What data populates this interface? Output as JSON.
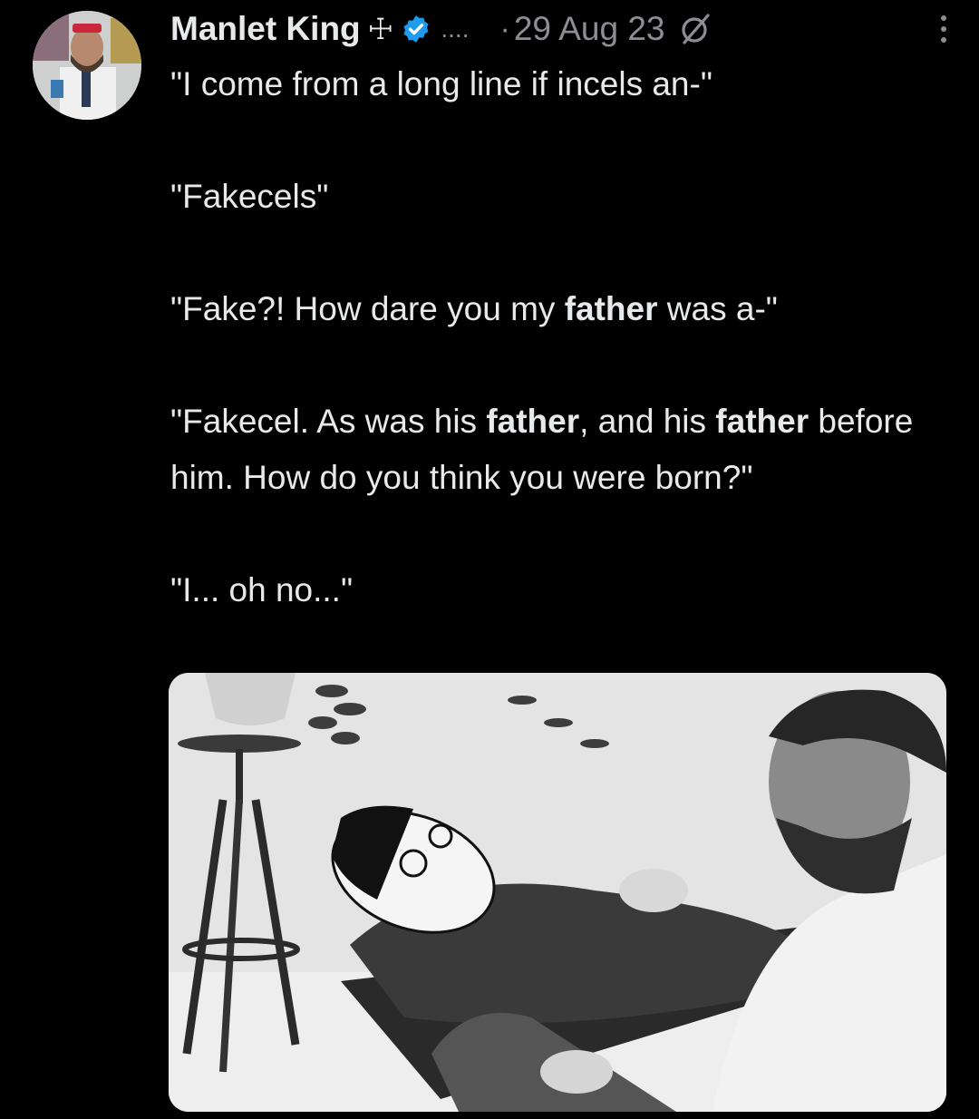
{
  "tweet": {
    "author_name": "Manlet King",
    "author_badge": "☩",
    "truncation": "....",
    "separator": "·",
    "date": "29 Aug 23",
    "lines": {
      "l1": "\"I come from a long line if incels an-\"",
      "l2": "\"Fakecels\"",
      "l3_pre": "\"Fake?! How dare you my ",
      "l3_bold": "father",
      "l3_post": " was a-\"",
      "l4_pre": "\"Fakecel. As was his ",
      "l4_bold": "father",
      "l4_mid": ", and his ",
      "l4_bold2": "father",
      "l4_post": " before him. How do you think you were born?\"",
      "l5": "\"I... oh no...\""
    }
  },
  "icons": {
    "verified": "verified-badge-icon",
    "grok": "grok-icon",
    "more": "more-vertical-icon"
  },
  "colors": {
    "background": "#000000",
    "text": "#e7e9ea",
    "muted": "#8b8f94",
    "verified": "#1d9bf0"
  }
}
